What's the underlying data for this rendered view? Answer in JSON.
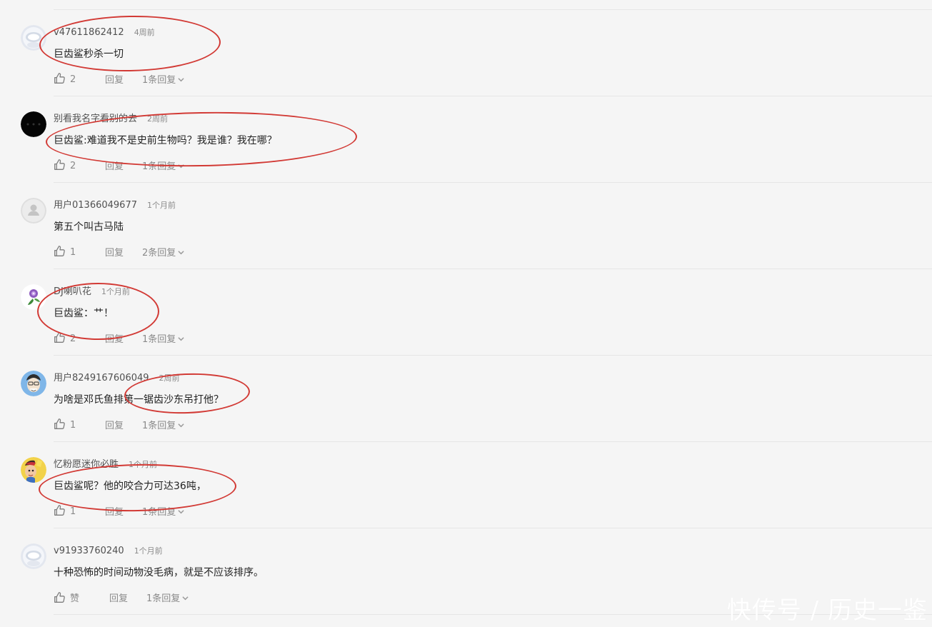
{
  "comments": [
    {
      "username": "v47611862412",
      "time": "4周前",
      "content": "巨齿鲨秒杀一切",
      "likes": "2",
      "reply_label": "回复",
      "replies_label": "1条回复",
      "avatar": "default-avatar-icon"
    },
    {
      "username": "别看我名字看别的去",
      "time": "2周前",
      "content": "巨齿鲨:难道我不是史前生物吗？我是谁？我在哪？",
      "likes": "2",
      "reply_label": "回复",
      "replies_label": "1条回复",
      "avatar": "dark-avatar"
    },
    {
      "username": "用户01366049677",
      "time": "1个月前",
      "content": "第五个叫古马陆",
      "likes": "1",
      "reply_label": "回复",
      "replies_label": "2条回复",
      "avatar": "user-silhouette-icon"
    },
    {
      "username": "DJ喇叭花",
      "time": "1个月前",
      "content": "巨齿鲨：艹！",
      "likes": "2",
      "reply_label": "回复",
      "replies_label": "1条回复",
      "avatar": "morning-glory-flower-avatar"
    },
    {
      "username": "用户8249167606049",
      "time": "2周前",
      "content": "为啥是邓氏鱼排第一锯齿沙东吊打他？",
      "likes": "1",
      "reply_label": "回复",
      "replies_label": "1条回复",
      "avatar": "cartoon-face-avatar"
    },
    {
      "username": "忆粉愿迷你必胜",
      "time": "1个月前",
      "content": "巨齿鲨呢？他的咬合力可达36吨，",
      "likes": "1",
      "reply_label": "回复",
      "replies_label": "1条回复",
      "avatar": "anime-character-avatar"
    },
    {
      "username": "v91933760240",
      "time": "1个月前",
      "content": "十种恐怖的时间动物没毛病，就是不应该排序。",
      "likes": "赞",
      "reply_label": "回复",
      "replies_label": "1条回复",
      "avatar": "default-avatar-icon"
    }
  ],
  "watermark": "快传号 / 历史一鉴",
  "colors": {
    "accent_circle": "#d23a35",
    "text_muted": "#8a8a8a",
    "background": "#f5f5f5"
  }
}
